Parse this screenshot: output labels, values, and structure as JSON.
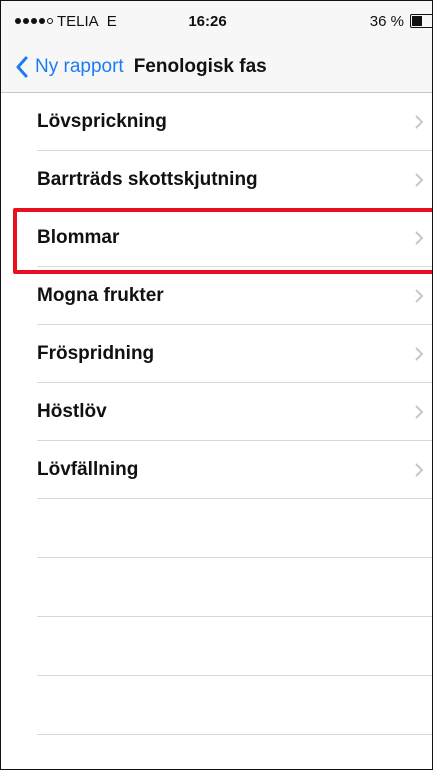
{
  "status_bar": {
    "signal_dots_filled": 4,
    "signal_dots_total": 5,
    "carrier": "TELIA",
    "network": "E",
    "time": "16:26",
    "battery_text": "36 %",
    "battery_level": 0.36
  },
  "nav": {
    "back_label": "Ny rapport",
    "title": "Fenologisk fas"
  },
  "list": {
    "items": [
      {
        "label": "Lövsprickning"
      },
      {
        "label": "Barrträds skottskjutning"
      },
      {
        "label": "Blommar"
      },
      {
        "label": "Mogna frukter"
      },
      {
        "label": "Fröspridning"
      },
      {
        "label": "Höstlöv"
      },
      {
        "label": "Lövfällning"
      }
    ],
    "highlighted_index": 2
  },
  "colors": {
    "accent": "#1c7cf4",
    "highlight": "#e8101c",
    "separator": "#d8d8dc",
    "chevron": "#c7c7cc"
  }
}
